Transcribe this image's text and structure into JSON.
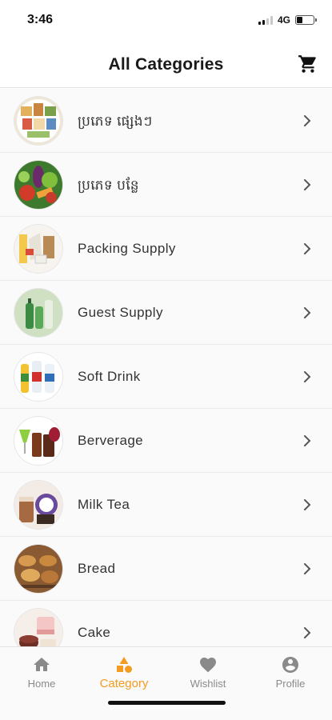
{
  "status_bar": {
    "time": "3:46",
    "network": "4G",
    "signal_bars": 2,
    "battery_level": 0.35
  },
  "header": {
    "title": "All Categories",
    "cart_icon": "cart-icon"
  },
  "categories": [
    {
      "label": "ប្រភេទ ផ្សេងៗ",
      "thumb": "assorted-goods"
    },
    {
      "label": "ប្រភេទ បន្លែ",
      "thumb": "vegetables"
    },
    {
      "label": "Packing Supply",
      "thumb": "packing-supply"
    },
    {
      "label": "Guest Supply",
      "thumb": "guest-supply"
    },
    {
      "label": "Soft Drink",
      "thumb": "soft-drink"
    },
    {
      "label": "Berverage",
      "thumb": "beverage"
    },
    {
      "label": "Milk Tea",
      "thumb": "milk-tea"
    },
    {
      "label": "Bread",
      "thumb": "bread"
    },
    {
      "label": "Cake",
      "thumb": "cake"
    }
  ],
  "tabbar": {
    "tabs": [
      {
        "label": "Home",
        "icon": "home-icon",
        "active": false
      },
      {
        "label": "Category",
        "icon": "category-icon",
        "active": true
      },
      {
        "label": "Wishlist",
        "icon": "heart-icon",
        "active": false
      },
      {
        "label": "Profile",
        "icon": "profile-icon",
        "active": false
      }
    ]
  },
  "colors": {
    "accent": "#f39c1f",
    "inactive": "#8a8a8a",
    "background": "#fafafa"
  }
}
